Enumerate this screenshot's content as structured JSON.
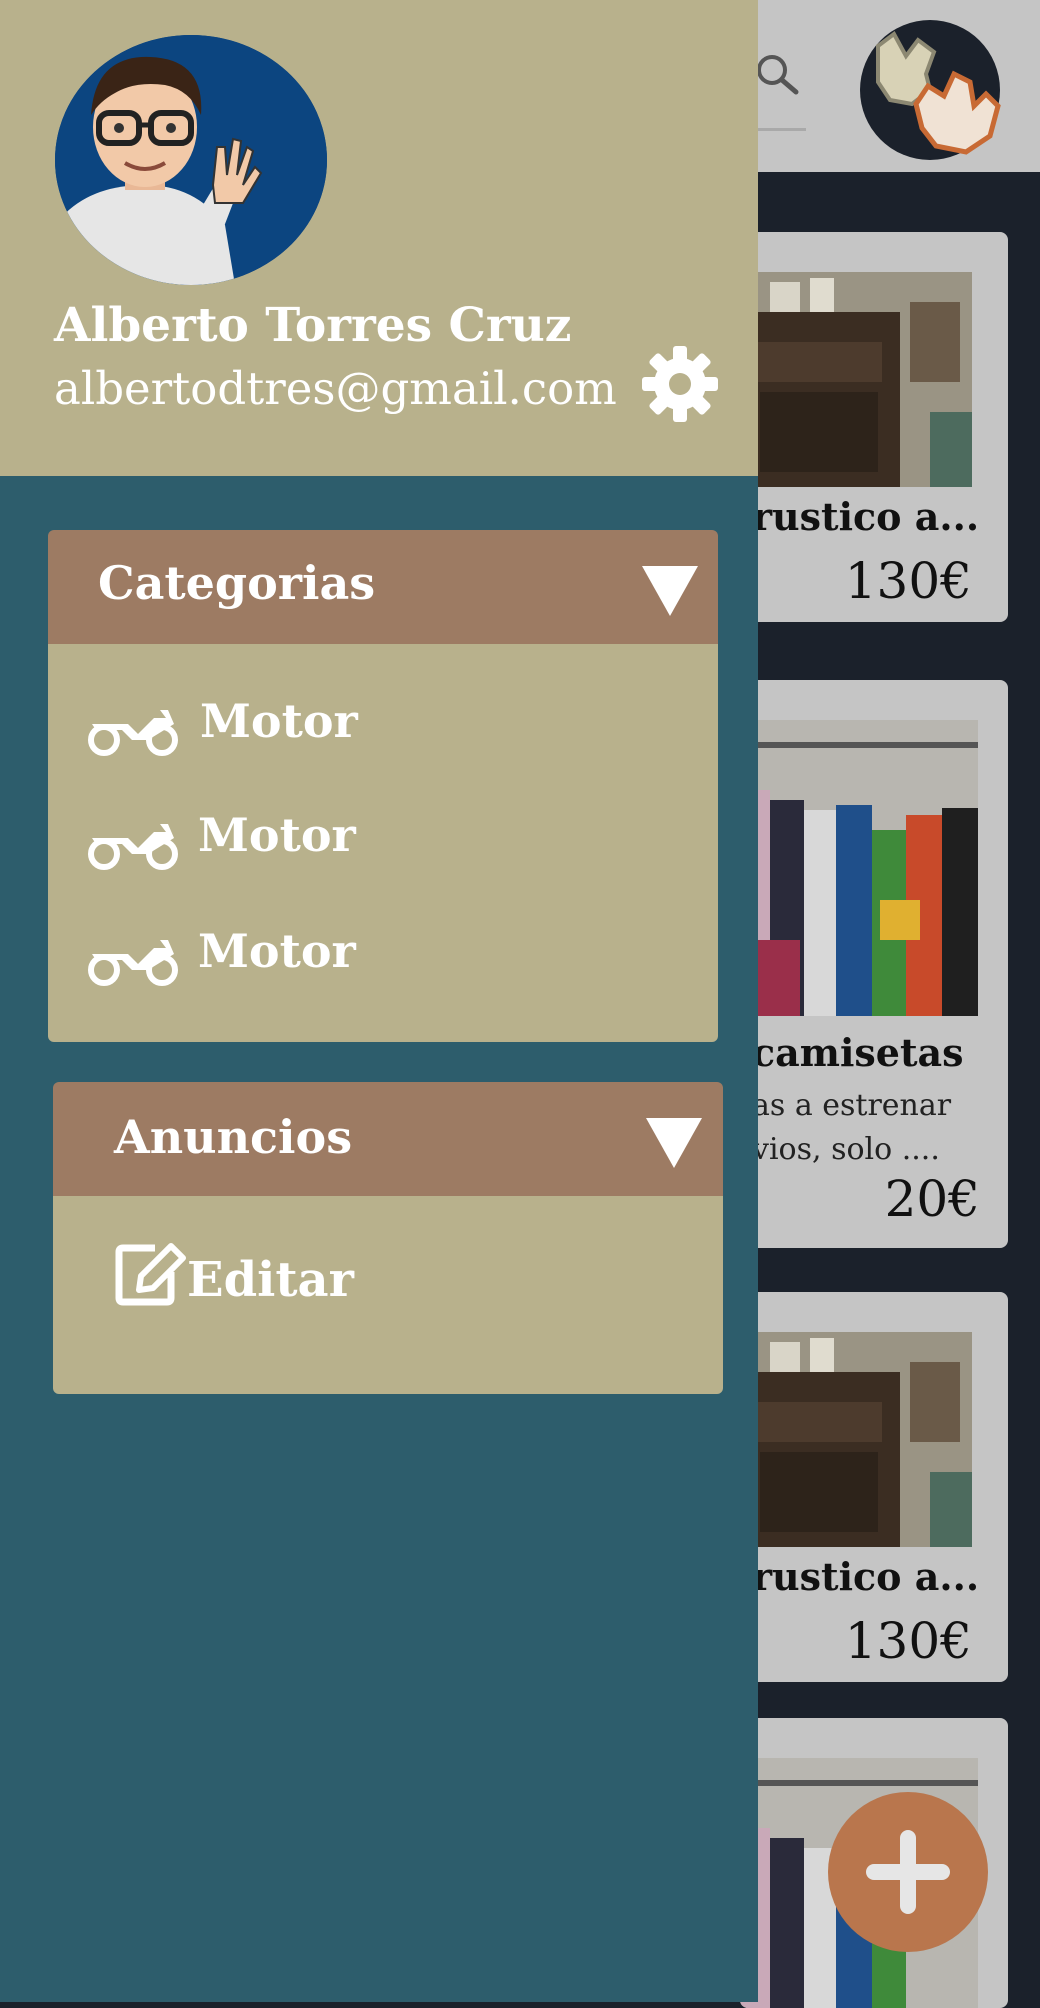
{
  "profile": {
    "name": "Alberto Torres Cruz",
    "email": "albertodtres@gmail.com"
  },
  "categories": {
    "title": "Categorias",
    "items": [
      {
        "label": "Motor",
        "icon": "motorcycle-icon"
      },
      {
        "label": "Motor",
        "icon": "motorcycle-icon"
      },
      {
        "label": "Motor",
        "icon": "motorcycle-icon"
      }
    ]
  },
  "ads": {
    "title": "Anuncios",
    "items": [
      {
        "label": "Editar",
        "icon": "edit-icon"
      }
    ]
  },
  "listings": [
    {
      "title": "rustico a...",
      "price": "130€"
    },
    {
      "title": "camisetas",
      "desc_line1": "as a estrenar",
      "desc_line2": "vios, solo ....",
      "price": "20€"
    },
    {
      "title": "rustico a...",
      "price": "130€"
    }
  ],
  "colors": {
    "drawer_bg": "#2d5d6c",
    "header_bg": "#b8b18c",
    "section_header": "#9d7b63",
    "fab": "#b9764d",
    "app_bg": "#1b212b"
  }
}
